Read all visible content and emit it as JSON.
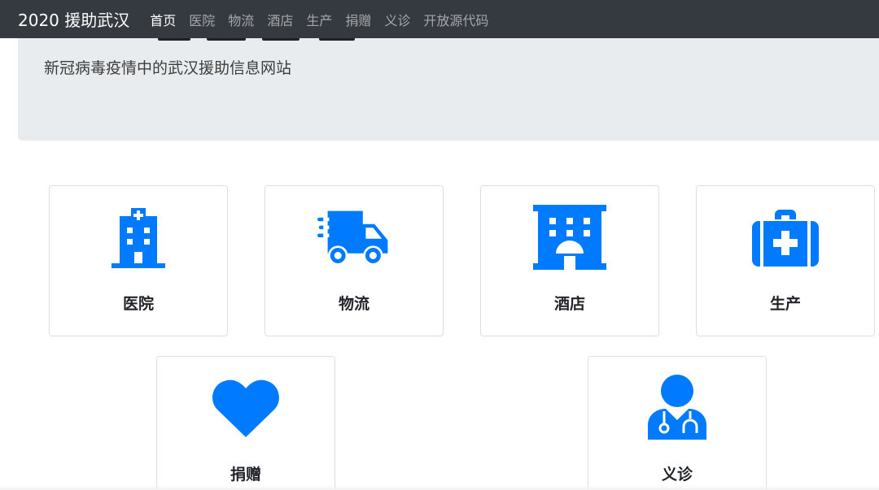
{
  "navbar": {
    "brand": "2020 援助武汉",
    "links": [
      {
        "label": "首页",
        "active": true
      },
      {
        "label": "医院"
      },
      {
        "label": "物流"
      },
      {
        "label": "酒店"
      },
      {
        "label": "生产"
      },
      {
        "label": "捐赠"
      },
      {
        "label": "义诊"
      },
      {
        "label": "开放源代码"
      }
    ]
  },
  "jumbotron": {
    "lead": "新冠病毒疫情中的武汉援助信息网站"
  },
  "cards": [
    {
      "label": "医院",
      "icon": "hospital-icon"
    },
    {
      "label": "物流",
      "icon": "delivery-truck-icon"
    },
    {
      "label": "酒店",
      "icon": "hotel-icon"
    },
    {
      "label": "生产",
      "icon": "medical-kit-icon"
    },
    {
      "label": "捐赠",
      "icon": "heart-icon"
    },
    {
      "label": "义诊",
      "icon": "doctor-icon"
    }
  ],
  "colors": {
    "navbar_bg": "#343a40",
    "jumbotron_bg": "#e9ecef",
    "icon_blue": "#007bff"
  }
}
